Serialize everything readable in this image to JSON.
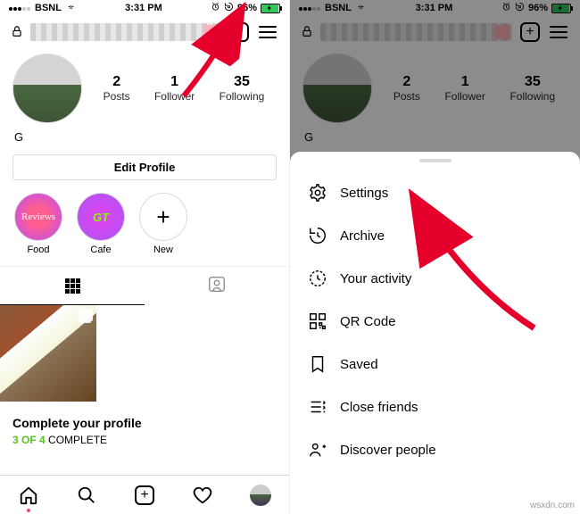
{
  "statusBar": {
    "carrier": "BSNL",
    "time": "3:31 PM",
    "alarmIcon": "alarm-icon",
    "rotateIcon": "rotation-lock-icon",
    "battery": "96%"
  },
  "profile": {
    "displayName": "G",
    "stats": [
      {
        "num": "2",
        "label": "Posts"
      },
      {
        "num": "1",
        "label": "Follower"
      },
      {
        "num": "35",
        "label": "Following"
      }
    ],
    "editProfile": "Edit Profile",
    "highlights": [
      {
        "label": "Food",
        "circleText": "Reviews"
      },
      {
        "label": "Cafe",
        "circleText": "GT"
      },
      {
        "label": "New",
        "circleText": "+"
      }
    ],
    "completeTitle": "Complete your profile",
    "completeDone": "3 OF 4",
    "completeRest": " COMPLETE"
  },
  "menu": [
    {
      "icon": "settings",
      "label": "Settings"
    },
    {
      "icon": "archive",
      "label": "Archive"
    },
    {
      "icon": "activity",
      "label": "Your activity"
    },
    {
      "icon": "qr",
      "label": "QR Code"
    },
    {
      "icon": "saved",
      "label": "Saved"
    },
    {
      "icon": "close-friends",
      "label": "Close friends"
    },
    {
      "icon": "discover",
      "label": "Discover people"
    }
  ],
  "watermark": "wsxdn.com"
}
